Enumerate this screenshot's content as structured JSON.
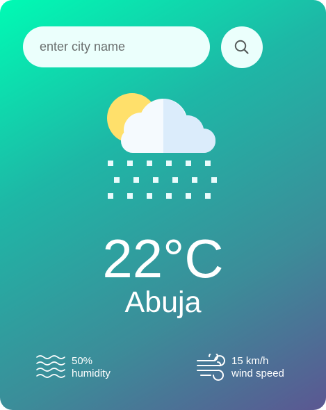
{
  "search": {
    "placeholder": "enter city name",
    "value": ""
  },
  "weather": {
    "icon": "snow-cloud-sun-icon",
    "temperature": "22°C",
    "city": "Abuja"
  },
  "details": {
    "humidity": {
      "value": "50%",
      "label": "humidity",
      "icon": "humidity-waves-icon"
    },
    "wind": {
      "value": "15 km/h",
      "label": "wind speed",
      "icon": "wind-icon"
    }
  },
  "colors": {
    "gradient_start": "#00fbb4",
    "gradient_end": "#5b5792",
    "search_bg": "#ebfffc"
  }
}
